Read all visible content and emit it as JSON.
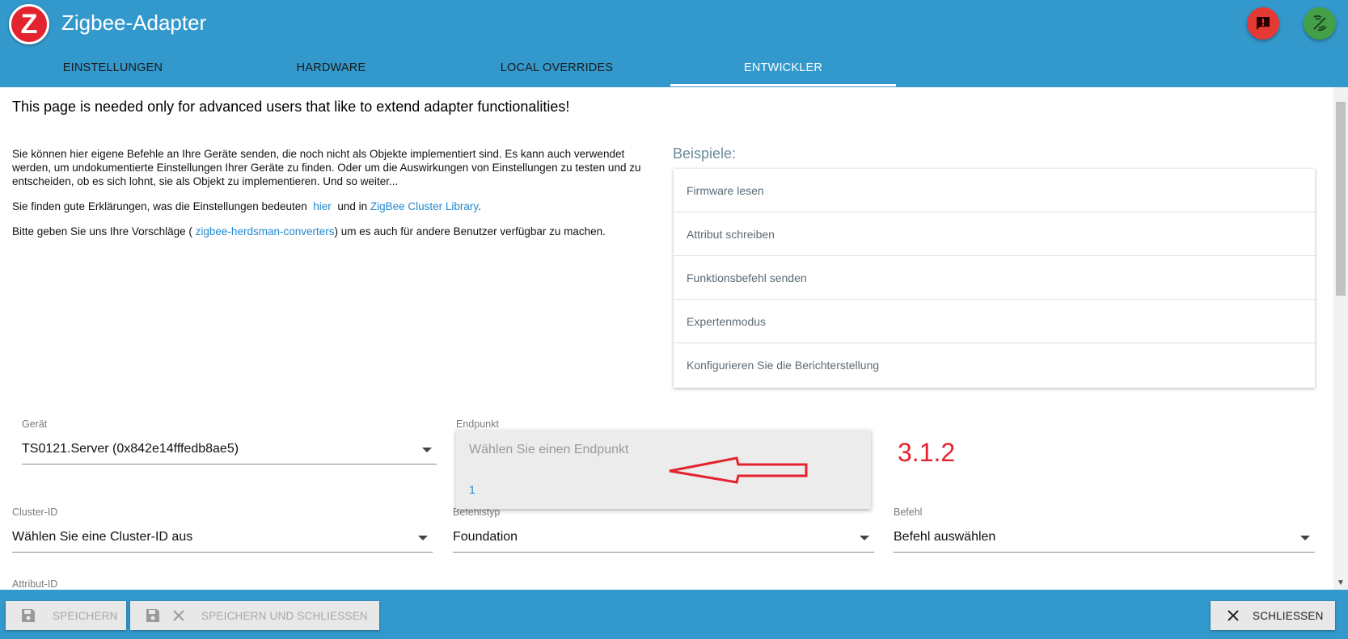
{
  "app": {
    "title": "Zigbee-Adapter",
    "logo_letter": "Z"
  },
  "header_actions": {
    "alert_icon": "alert-icon",
    "signal_icon": "zigbee-signal-icon"
  },
  "tabs": [
    {
      "label": "EINSTELLUNGEN"
    },
    {
      "label": "HARDWARE"
    },
    {
      "label": "LOCAL OVERRIDES"
    },
    {
      "label": "ENTWICKLER",
      "active": true
    }
  ],
  "intro": {
    "headline": "This page is needed only for advanced users that like to extend adapter functionalities!",
    "paragraph": "Sie können hier eigene Befehle an Ihre Geräte senden, die noch nicht als Objekte implementiert sind. Es kann auch verwendet werden, um undokumentierte Einstellungen Ihrer Geräte zu finden. Oder um die Auswirkungen von Einstellungen zu testen und zu entscheiden, ob es sich lohnt, sie als Objekt zu implementieren. Und so weiter...",
    "explain_prefix": "Sie finden gute Erklärungen, was die Einstellungen bedeuten",
    "explain_link1": "hier",
    "explain_mid": "und in",
    "explain_link2": "ZigBee Cluster Library",
    "explain_suffix": ".",
    "suggest_prefix": "Bitte geben Sie uns Ihre Vorschläge (",
    "suggest_link": "zigbee-herdsman-converters",
    "suggest_suffix": ") um es auch für andere Benutzer verfügbar zu machen."
  },
  "examples": {
    "title": "Beispiele:",
    "items": [
      "Firmware lesen",
      "Attribut schreiben",
      "Funktionsbefehl senden",
      "Expertenmodus",
      "Konfigurieren Sie die Berichterstellung"
    ]
  },
  "form": {
    "device": {
      "label": "Gerät",
      "value": "TS0121.Server (0x842e14fffedb8ae5)"
    },
    "endpoint": {
      "label": "Endpunkt",
      "placeholder": "Wählen Sie einen Endpunkt",
      "options": [
        "1"
      ]
    },
    "cluster": {
      "label": "Cluster-ID",
      "value": "Wählen Sie eine Cluster-ID aus"
    },
    "command_type": {
      "label": "Befehlstyp",
      "value": "Foundation"
    },
    "command": {
      "label": "Befehl",
      "value": "Befehl auswählen"
    },
    "attribute": {
      "label": "Attribut-ID"
    }
  },
  "annotation": {
    "version_text": "3.1.2",
    "color": "#e3232e"
  },
  "footer": {
    "save_label": "SPEICHERN",
    "save_close_label": "SPEICHERN UND SCHLIESSEN",
    "close_label": "SCHLIESSEN"
  },
  "colors": {
    "primary": "#3399cc",
    "link": "#1e88d0",
    "alert": "#e53935",
    "signal": "#43a047"
  }
}
